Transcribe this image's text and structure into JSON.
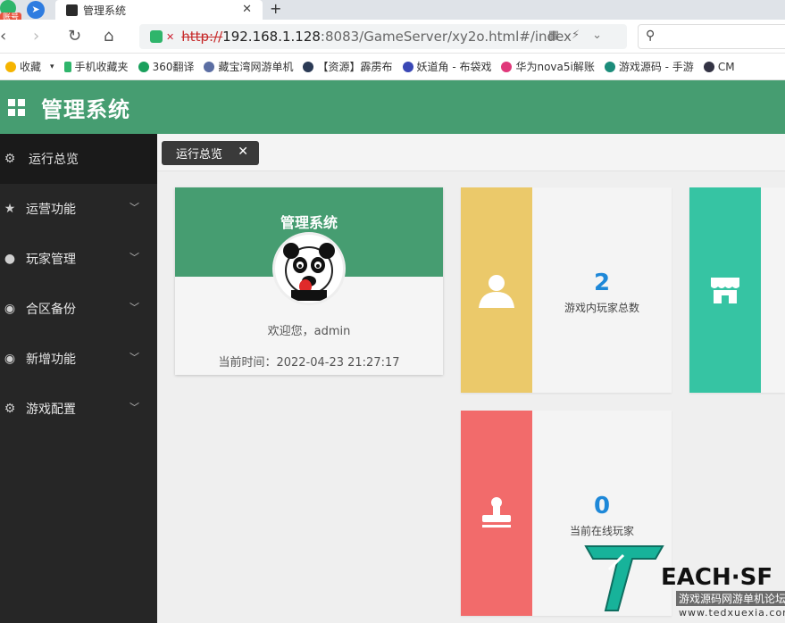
{
  "browser": {
    "pin_badge": "账号",
    "tab_title": "管理系统",
    "url_proto": "http://",
    "url_host": "192.168.1.128",
    "url_path": ":8083/GameServer/xy2o.html#/index",
    "bookmarks": [
      {
        "label": "收藏",
        "color": "#f5b400"
      },
      {
        "label": "手机收藏夹",
        "color": "#2fb56b"
      },
      {
        "label": "360翻译",
        "color": "#19a05c"
      },
      {
        "label": "藏宝湾网游单机",
        "color": "#5b6ea3"
      },
      {
        "label": "【资源】霹雳布",
        "color": "#2b3a55"
      },
      {
        "label": "妖道角 - 布袋戏",
        "color": "#3a48b5"
      },
      {
        "label": "华为nova5i解账",
        "color": "#e0387a"
      },
      {
        "label": "游戏源码 - 手游",
        "color": "#1b8c7a"
      },
      {
        "label": "CM",
        "color": "#333344"
      }
    ]
  },
  "app": {
    "title": "管理系统"
  },
  "sidebar": {
    "items": [
      {
        "label": "运行总览",
        "icon": "gear-icon",
        "active": true
      },
      {
        "label": "运营功能",
        "icon": "star-icon"
      },
      {
        "label": "玩家管理",
        "icon": "user-icon"
      },
      {
        "label": "合区备份",
        "icon": "eye-icon"
      },
      {
        "label": "新增功能",
        "icon": "eye-icon"
      },
      {
        "label": "游戏配置",
        "icon": "gear-icon"
      }
    ]
  },
  "tabs": {
    "current": "运行总览"
  },
  "profile": {
    "title": "管理系统",
    "welcome": "欢迎您，admin",
    "time": "当前时间：2022-04-23 21:27:17"
  },
  "stats": {
    "players_total": {
      "value": "2",
      "label": "游戏内玩家总数",
      "color": "#ebc96a"
    },
    "online": {
      "value": "0",
      "label": "当前在线玩家",
      "color": "#f26b6b"
    },
    "shop": {
      "color": "#36c4a3"
    }
  },
  "watermark": {
    "brand": "EACH·SF",
    "caption": "游戏源码网游单机论坛",
    "url": "www.tedxuexia.com"
  }
}
